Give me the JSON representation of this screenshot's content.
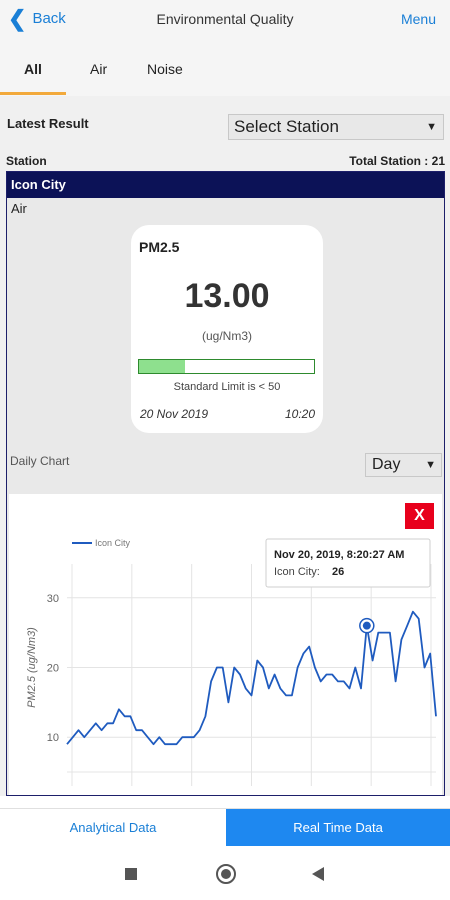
{
  "header": {
    "back_label": "Back",
    "title": "Environmental Quality",
    "menu_label": "Menu"
  },
  "tabs": [
    {
      "label": "All",
      "active": true
    },
    {
      "label": "Air"
    },
    {
      "label": "Noise"
    }
  ],
  "latest": {
    "label": "Latest Result",
    "station_select": "Select Station"
  },
  "station_list": {
    "label": "Station",
    "total": "Total Station : 21"
  },
  "station": {
    "name": "Icon City",
    "category": "Air",
    "card": {
      "parameter": "PM2.5",
      "value": "13.00",
      "unit": "(ug/Nm3)",
      "level_fraction": 0.26,
      "limit_text": "Standard Limit is < 50",
      "date": "20 Nov 2019",
      "time": "10:20"
    }
  },
  "daily": {
    "label": "Daily Chart",
    "period": "Day",
    "close_label": "X"
  },
  "chart_data": {
    "type": "line",
    "series": [
      {
        "name": "Icon City",
        "color": "#1f5bbf",
        "values": [
          9,
          10,
          11,
          10,
          11,
          12,
          11,
          12,
          12,
          14,
          13,
          13,
          11,
          11,
          10,
          9,
          10,
          9,
          9,
          9,
          10,
          10,
          10,
          11,
          13,
          18,
          20,
          20,
          15,
          20,
          19,
          17,
          16,
          21,
          20,
          17,
          19,
          17,
          16,
          16,
          20,
          22,
          23,
          20,
          18,
          19,
          19,
          18,
          18,
          17,
          20,
          17,
          26,
          21,
          25,
          25,
          25,
          18,
          24,
          26,
          28,
          27,
          20,
          22,
          13
        ]
      }
    ],
    "ylabel": "PM2.5 (ug/Nm3)",
    "y_ticks": [
      "10",
      "20",
      "30"
    ],
    "ylim": [
      3,
      37
    ],
    "tooltip": {
      "date": "Nov 20, 2019, 8:20:27 AM",
      "series_label": "Icon City:",
      "value": "26"
    },
    "grid": true,
    "legend": "top-left"
  },
  "bottom_tabs": {
    "analytical": "Analytical Data",
    "realtime": "Real Time Data"
  },
  "system_nav": {
    "recents": "square-icon",
    "home": "circle-icon",
    "back": "triangle-back-icon"
  }
}
